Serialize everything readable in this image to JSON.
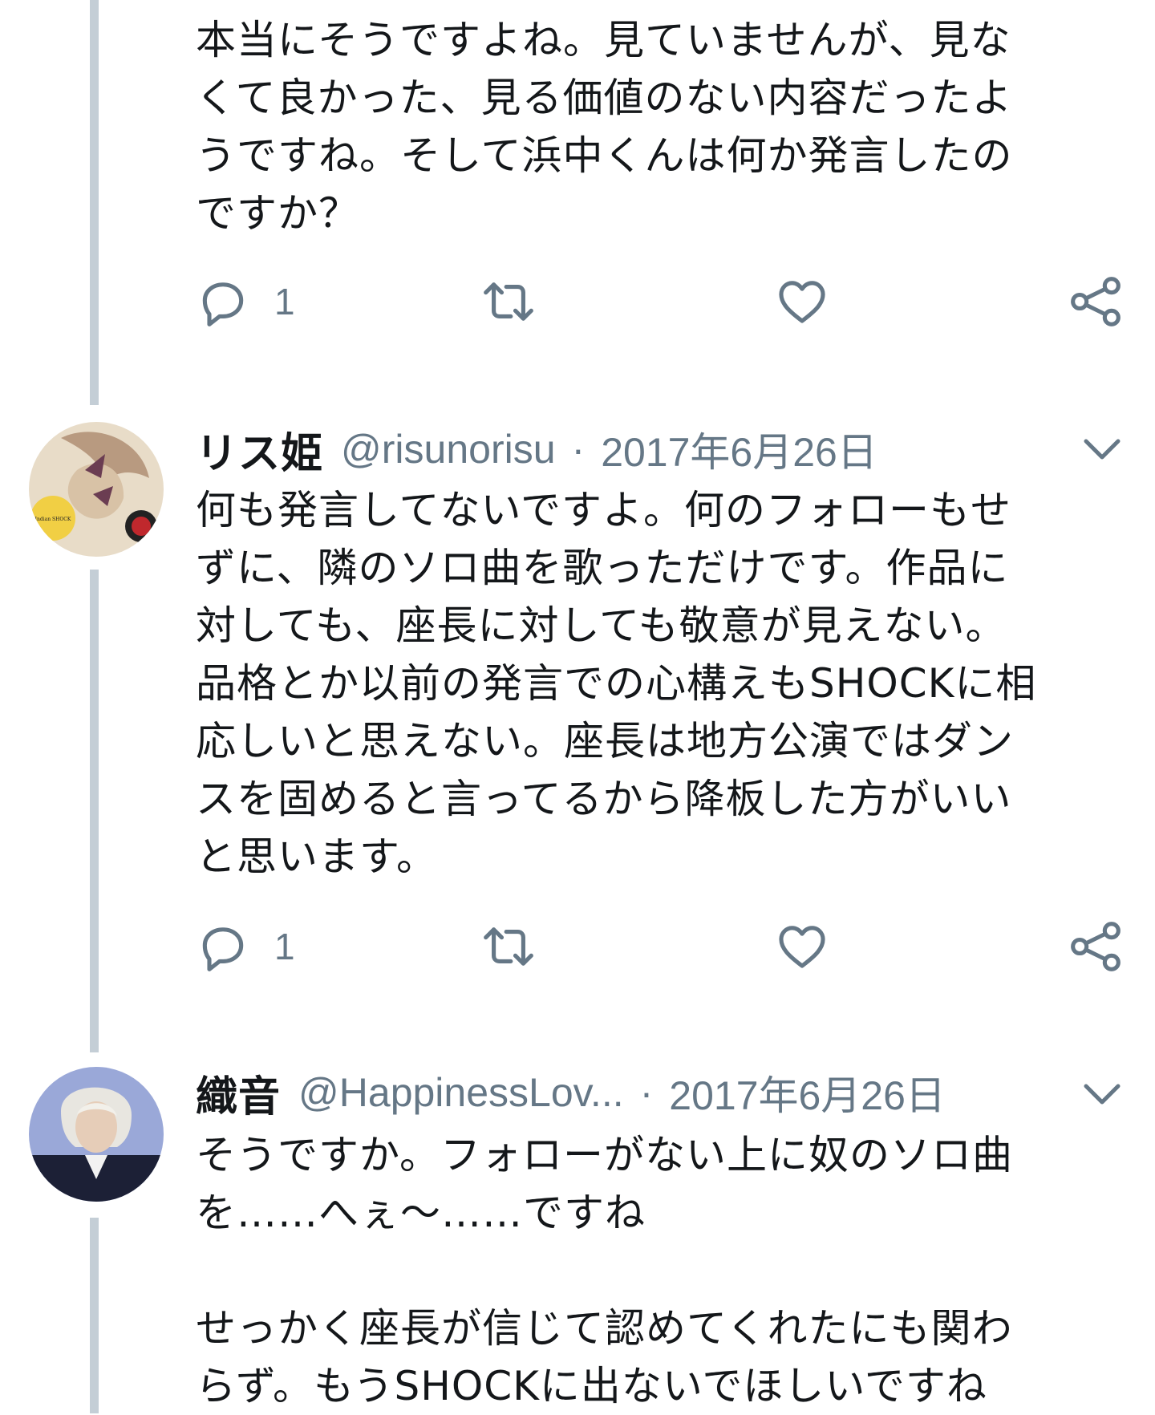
{
  "tweets": [
    {
      "text": "本当にそうですよね。見ていませんが、見な\nくて良かった、見る価値のない内容だったよ\nうですね。そして浜中くんは何か発言したの\nですか？",
      "reply_count": "1"
    },
    {
      "name": "リス姫",
      "handle": "@risunorisu",
      "separator": "·",
      "date": "2017年6月26日",
      "text": "何も発言してないですよ。何のフォローもせ\nずに、隣のソロ曲を歌っただけです。作品に\n対しても、座長に対しても敬意が見えない。\n品格とか以前の発言での心構えもSHOCKに相\n応しいと思えない。座長は地方公演ではダン\nスを固めると言ってるから降板した方がいい\nと思います。",
      "reply_count": "1",
      "avatar_text": "Indian SHOCK"
    },
    {
      "name": "織音",
      "handle": "@HappinessLov...",
      "separator": "·",
      "date": "2017年6月26日",
      "text": "そうですか。フォローがない上に奴のソロ曲\nを……へぇ～……ですね\n\nせっかく座長が信じて認めてくれたにも関わ\nらず。もうSHOCKに出ないでほしいですね"
    }
  ],
  "colors": {
    "text": "#14171a",
    "secondary": "#657786",
    "thread_line": "#c4ced6"
  },
  "icons": [
    "reply-icon",
    "retweet-icon",
    "like-icon",
    "share-icon",
    "chevron-down-icon"
  ]
}
